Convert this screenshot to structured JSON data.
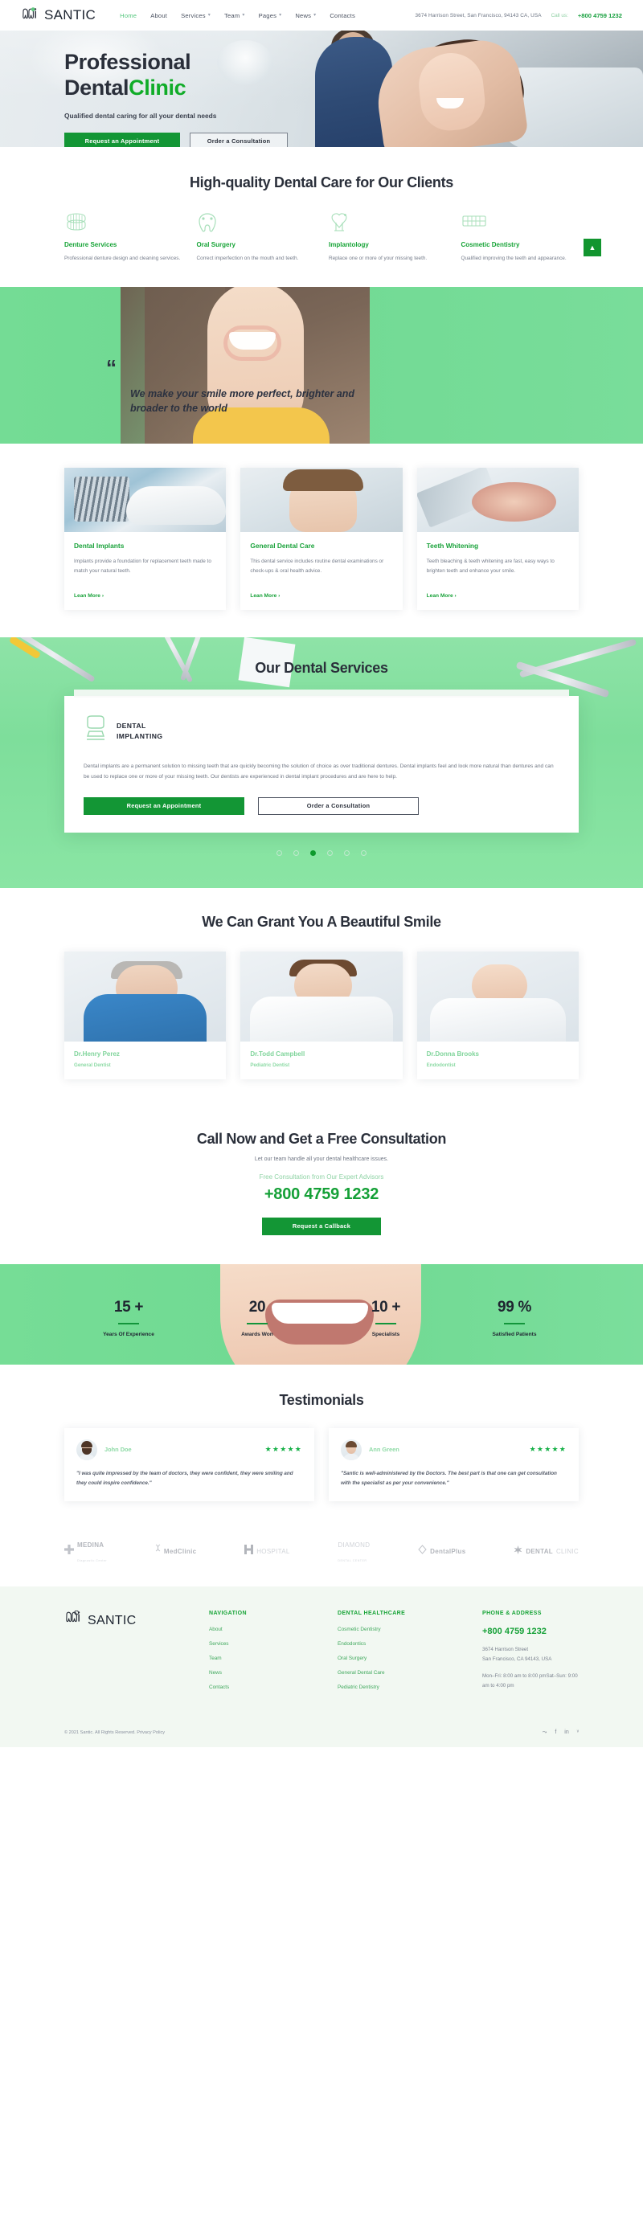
{
  "brand": {
    "name": "SANTIC",
    "logo_icon": "tooth-logo-icon"
  },
  "header": {
    "nav": [
      {
        "label": "Home",
        "has_caret": false,
        "active": true
      },
      {
        "label": "About",
        "has_caret": false,
        "active": false
      },
      {
        "label": "Services",
        "has_caret": true,
        "active": false
      },
      {
        "label": "Team",
        "has_caret": true,
        "active": false
      },
      {
        "label": "Pages",
        "has_caret": true,
        "active": false
      },
      {
        "label": "News",
        "has_caret": true,
        "active": false
      },
      {
        "label": "Contacts",
        "has_caret": false,
        "active": false
      }
    ],
    "address": "3674 Harrison Street, San Francisco, 94143 CA, USA",
    "call_label": "Call us:",
    "phone": "+800 4759 1232"
  },
  "hero": {
    "title_line1": "Professional",
    "title_line2_dark": "Dental",
    "title_line2_green": "Clinic",
    "subtitle": "Qualified dental caring for all your dental needs",
    "btn_primary": "Request an Appointment",
    "btn_secondary": "Order a Consultation"
  },
  "services": {
    "heading": "High-quality Dental Care for Our Clients",
    "items": [
      {
        "icon": "denture-icon",
        "title": "Denture Services",
        "desc": "Professional denture design and cleaning services."
      },
      {
        "icon": "oral-surgery-icon",
        "title": "Oral Surgery",
        "desc": "Correct imperfection on the mouth and teeth."
      },
      {
        "icon": "implant-icon",
        "title": "Implantology",
        "desc": "Replace one or more of your missing teeth."
      },
      {
        "icon": "braces-icon",
        "title": "Cosmetic Dentistry",
        "desc": "Qualified improving the teeth and appearance."
      }
    ],
    "scroll_top_icon": "arrow-up-icon"
  },
  "quote": {
    "mark": "“",
    "text": "We make your smile more perfect, brighter and broader to the world"
  },
  "cards": [
    {
      "title": "Dental Implants",
      "desc": "Implants provide a foundation for replacement teeth made to match your natural teeth.",
      "link": "Lean More",
      "arrow": "›"
    },
    {
      "title": "General Dental Care",
      "desc": "This dental service includes routine dental examinations or check-ups & oral health advice.",
      "link": "Lean More",
      "arrow": "›"
    },
    {
      "title": "Teeth Whitening",
      "desc": "Teeth bleaching & teeth whitening are fast, easy ways to brighten teeth and enhance your smile.",
      "link": "Lean More",
      "arrow": "›"
    }
  ],
  "dental_services": {
    "heading": "Our Dental Services",
    "icon": "dental-implant-icon",
    "card_title_line1": "DENTAL",
    "card_title_line2": "IMPLANTING",
    "card_body": "Dental implants are a permanent solution to missing teeth that are quickly becoming the solution of choice as over traditional dentures. Dental implants feel and look more natural than dentures and can be used to replace one or more of your missing teeth. Our dentists are experienced in dental implant procedures and are here to help.",
    "btn_primary": "Request an Appointment",
    "btn_secondary": "Order a Consultation",
    "dots_total": 6,
    "dots_active_index": 2
  },
  "team": {
    "heading": "We Can Grant You A Beautiful Smile",
    "members": [
      {
        "name": "Dr.Henry Perez",
        "role": "General Dentist"
      },
      {
        "name": "Dr.Todd Campbell",
        "role": "Pediatric Dentist"
      },
      {
        "name": "Dr.Donna Brooks",
        "role": "Endodontist"
      }
    ]
  },
  "cta": {
    "heading": "Call Now and Get a Free Consultation",
    "subtitle": "Let our team handle all your dental healthcare issues.",
    "advisor_text": "Free Consultation from Our Expert Advisors",
    "phone": "+800 4759 1232",
    "button": "Request a Callback"
  },
  "stats": [
    {
      "value": "15 +",
      "label": "Years Of Experience"
    },
    {
      "value": "20",
      "label": "Awards Won"
    },
    {
      "value": "10 +",
      "label": "Specialists"
    },
    {
      "value": "99 %",
      "label": "Satisfied Patients"
    }
  ],
  "testimonials": {
    "heading": "Testimonials",
    "items": [
      {
        "name": "John Doe",
        "stars": "★★★★★",
        "text": "\"I was quite impressed by the team of doctors, they were confident, they were smiling and they could inspire confidence.\""
      },
      {
        "name": "Ann Green",
        "stars": "★★★★★",
        "text": "\"Santic is well-administered by the Doctors. The best part is that one can get consultation with the specialist as per your convenience.\""
      }
    ]
  },
  "partners": [
    {
      "icon": "cross-icon",
      "name": "MEDINA",
      "sub": "Diagnostic Center"
    },
    {
      "icon": "dna-icon",
      "name": "MedClinic",
      "sub": ""
    },
    {
      "icon": "h-icon",
      "name": "HOSPITAL",
      "sub": ""
    },
    {
      "icon": "",
      "name": "DIAMOND",
      "sub": "DENTAL CENTER"
    },
    {
      "icon": "diamond-icon",
      "name": "DentalPlus",
      "sub": ""
    },
    {
      "icon": "star-icon",
      "name": "DENTAL",
      "name2": "CLINIC",
      "sub": ""
    }
  ],
  "footer": {
    "nav_heading": "NAVIGATION",
    "nav_links": [
      "About",
      "Services",
      "Team",
      "News",
      "Contacts"
    ],
    "health_heading": "DENTAL HEALTHCARE",
    "health_links": [
      "Cosmetic Dentistry",
      "Endodontics",
      "Oral Surgery",
      "General Dental Care",
      "Pediatric Dentistry"
    ],
    "contact_heading": "PHONE & ADDRESS",
    "phone": "+800 4759 1232",
    "address_line1": "3674 Harrison Street",
    "address_line2": "San Francisco, CA 94143, USA",
    "hours": "Mon–Fri: 8:00 am to 8:00 pmSat–Sun: 9:00 am to 4:00 pm",
    "copyright": "© 2021 Santic. All Rights Reserved. Privacy Policy",
    "socials": [
      {
        "icon": "rss-icon",
        "glyph": "⤳"
      },
      {
        "icon": "facebook-icon",
        "glyph": "f"
      },
      {
        "icon": "linkedin-icon",
        "glyph": "in"
      },
      {
        "icon": "twitter-icon",
        "glyph": "ᵛ"
      }
    ]
  },
  "colors": {
    "green": "#17a437",
    "dark_green": "#139635",
    "mint": "#7ede9b",
    "text_dark": "#2a2f3a",
    "muted": "#767d8b"
  }
}
